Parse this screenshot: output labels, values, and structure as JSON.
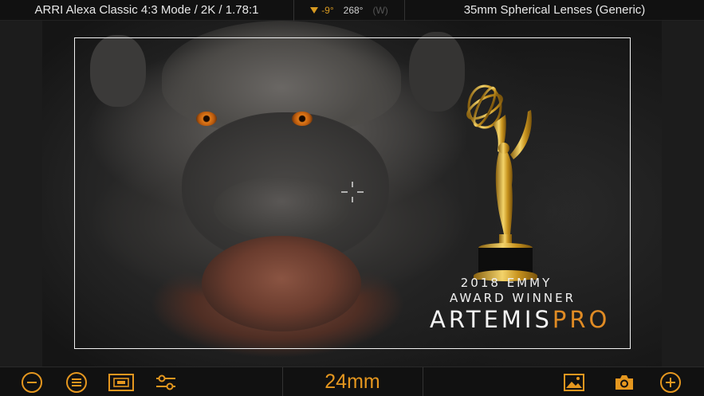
{
  "topbar": {
    "camera_format": "ARRI Alexa Classic 4:3 Mode / 2K / 1.78:1",
    "tilt": "-9°",
    "heading": "268°",
    "compass": "(W)",
    "lens_set": "35mm Spherical Lenses (Generic)"
  },
  "overlay": {
    "emmy_year": "2018 EMMY",
    "emmy_award": "AWARD WINNER",
    "brand_part1": "ARTEMIS",
    "brand_part2": "PRO"
  },
  "toolbar": {
    "focal_length": "24mm",
    "buttons": [
      "zoom-out",
      "menu",
      "frame-lines",
      "settings",
      "gallery",
      "capture",
      "zoom-in"
    ]
  },
  "colors": {
    "accent": "#e5971f",
    "background": "#111111",
    "frameline": "#f2f2f2"
  }
}
